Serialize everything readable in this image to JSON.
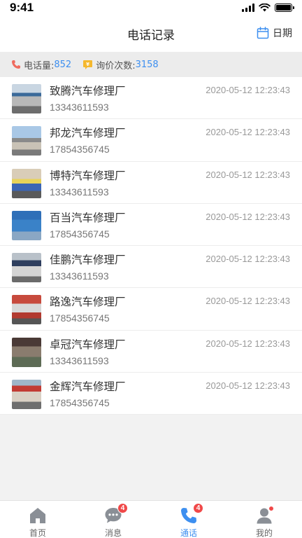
{
  "status_bar": {
    "time": "9:41"
  },
  "nav": {
    "title": "电话记录",
    "date_label": "日期"
  },
  "summary": {
    "calls_label": "电话量:",
    "calls_value": "852",
    "inquiries_label": "询价次数:",
    "inquiries_value": "3158"
  },
  "records": [
    {
      "name": "致腾汽车修理厂",
      "phone": "13343611593",
      "time": "2020-05-12 12:23:43"
    },
    {
      "name": "邦龙汽车修理厂",
      "phone": "17854356745",
      "time": "2020-05-12 12:23:43"
    },
    {
      "name": "博特汽车修理厂",
      "phone": "13343611593",
      "time": "2020-05-12 12:23:43"
    },
    {
      "name": "百当汽车修理厂",
      "phone": "17854356745",
      "time": "2020-05-12 12:23:43"
    },
    {
      "name": "佳鹏汽车修理厂",
      "phone": "13343611593",
      "time": "2020-05-12 12:23:43"
    },
    {
      "name": "路逸汽车修理厂",
      "phone": "17854356745",
      "time": "2020-05-12 12:23:43"
    },
    {
      "name": "卓冠汽车修理厂",
      "phone": "13343611593",
      "time": "2020-05-12 12:23:43"
    },
    {
      "name": "金辉汽车修理厂",
      "phone": "17854356745",
      "time": "2020-05-12 12:23:43"
    }
  ],
  "tabs": [
    {
      "label": "首页",
      "icon": "home-icon",
      "badge": ""
    },
    {
      "label": "消息",
      "icon": "message-icon",
      "badge": "4"
    },
    {
      "label": "通话",
      "icon": "phone-icon",
      "badge": "4",
      "active": true
    },
    {
      "label": "我的",
      "icon": "profile-icon",
      "badge": ""
    }
  ],
  "colors": {
    "accent": "#3d8ff0",
    "badge": "#f04848",
    "summary_bg": "#ececec"
  }
}
